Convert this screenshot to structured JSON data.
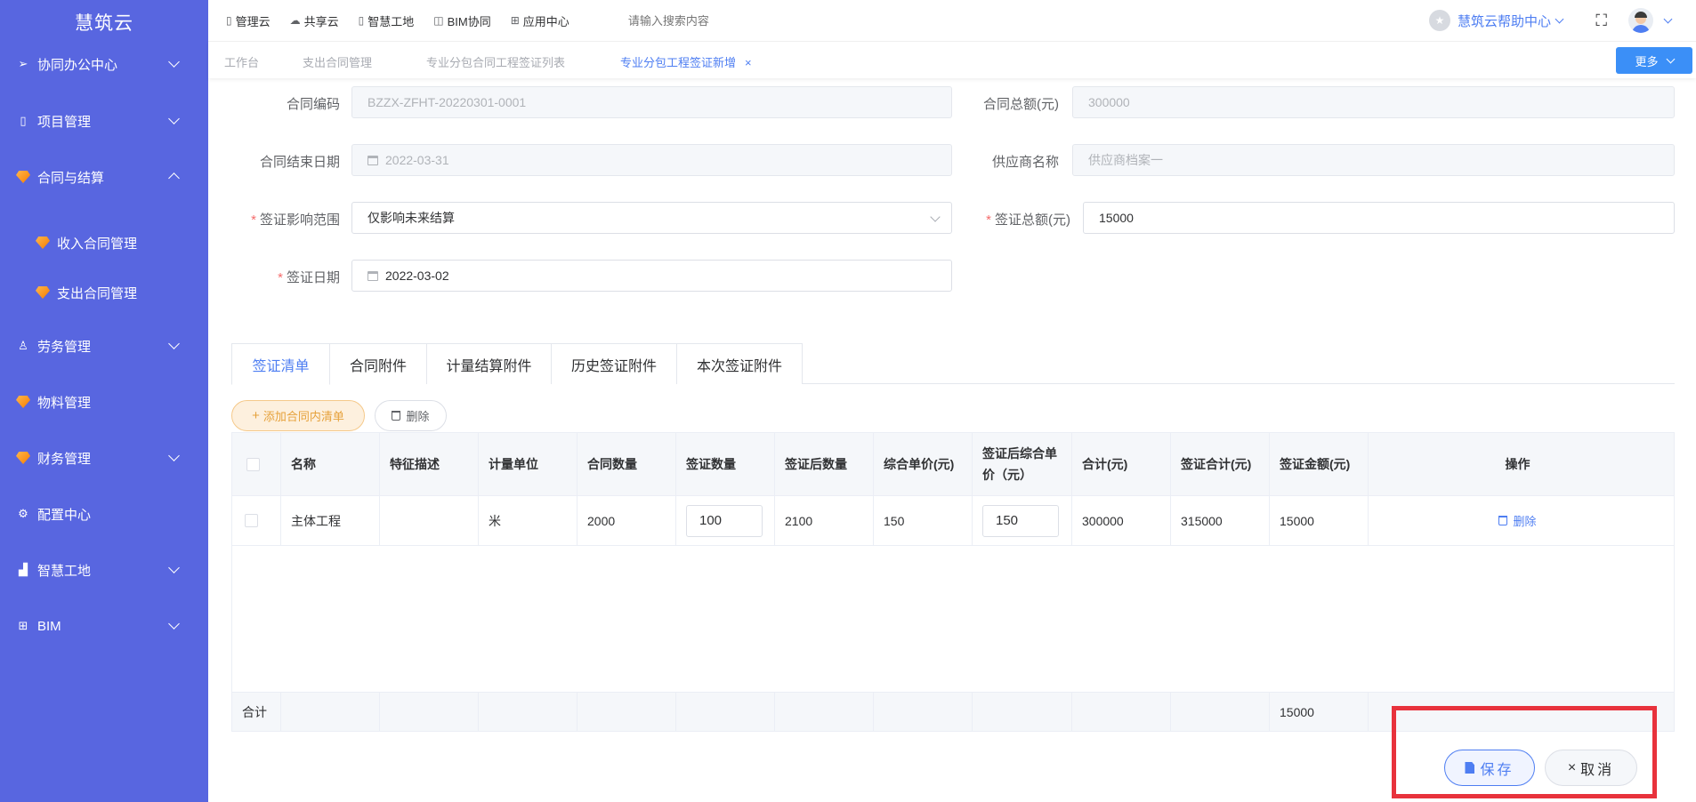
{
  "sidebar": {
    "brand": "慧筑云",
    "items": [
      {
        "label": "协同办公中心",
        "icon": "send-icon"
      },
      {
        "label": "项目管理",
        "icon": "book-icon"
      },
      {
        "label": "合同与结算",
        "icon": "gem-icon"
      },
      {
        "label": "收入合同管理",
        "icon": "gem-icon"
      },
      {
        "label": "支出合同管理",
        "icon": "gem-icon"
      },
      {
        "label": "劳务管理",
        "icon": "user-icon"
      },
      {
        "label": "物料管理",
        "icon": "gem-icon"
      },
      {
        "label": "财务管理",
        "icon": "gem-icon"
      },
      {
        "label": "配置中心",
        "icon": "gear-icon"
      },
      {
        "label": "智慧工地",
        "icon": "bar-chart-icon"
      },
      {
        "label": "BIM",
        "icon": "grid-icon"
      }
    ]
  },
  "topbar": {
    "nav": [
      "管理云",
      "共享云",
      "智慧工地",
      "BIM协同",
      "应用中心"
    ],
    "search_placeholder": "请输入搜索内容",
    "help": "慧筑云帮助中心"
  },
  "tabs": {
    "items": [
      "工作台",
      "支出合同管理",
      "专业分包合同工程签证列表",
      "专业分包工程签证新增"
    ],
    "close": "×",
    "more": "更多"
  },
  "form": {
    "contract_no_label": "合同编码",
    "contract_no": "BZZX-ZFHT-20220301-0001",
    "contract_total_label": "合同总额(元)",
    "contract_total": "300000",
    "end_date_label": "合同结束日期",
    "end_date": "2022-03-31",
    "supplier_label": "供应商名称",
    "supplier": "供应商档案一",
    "scope_label": "签证影响范围",
    "scope": "仅影响未来结算",
    "visa_total_label": "签证总额(元)",
    "visa_total": "15000",
    "visa_date_label": "签证日期",
    "visa_date": "2022-03-02",
    "required_mark": "*"
  },
  "content_tabs": [
    "签证清单",
    "合同附件",
    "计量结算附件",
    "历史签证附件",
    "本次签证附件"
  ],
  "toolbar": {
    "add": "添加合同内清单",
    "add_plus": "+",
    "delete": "删除"
  },
  "table": {
    "headers": [
      "名称",
      "特征描述",
      "计量单位",
      "合同数量",
      "签证数量",
      "签证后数量",
      "综合单价(元)",
      "签证后综合单价（元）",
      "合计(元)",
      "签证合计(元)",
      "签证金额(元)",
      "操作"
    ],
    "rows": [
      {
        "name": "主体工程",
        "desc": "",
        "unit": "米",
        "contract_qty": "2000",
        "visa_qty": "100",
        "after_qty": "2100",
        "unit_price": "150",
        "after_price": "150",
        "total": "300000",
        "visa_total": "315000",
        "visa_amount": "15000",
        "op": "删除"
      }
    ],
    "footer_label": "合计",
    "footer_visa_amount": "15000"
  },
  "actions": {
    "save": "保存",
    "cancel": "取消",
    "cancel_x": "×"
  },
  "colors": {
    "sidebar": "#5866e0",
    "primary": "#4e7ef2",
    "highlight": "#e8323c"
  }
}
